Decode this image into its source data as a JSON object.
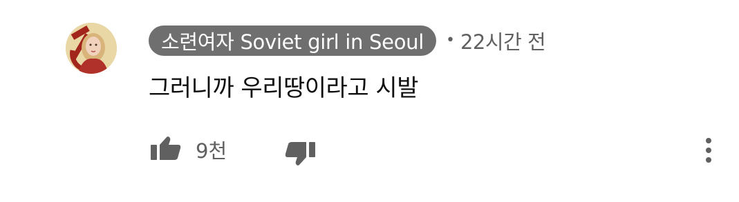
{
  "comment": {
    "author": "소련여자 Soviet girl in Seoul",
    "separator": "•",
    "timestamp": "22시간 전",
    "text": "그러니까 우리땅이라고 시발",
    "like_count": "9천"
  },
  "icons": {
    "like": "thumbs-up-icon",
    "dislike": "thumbs-down-icon",
    "more": "more-vertical-icon"
  },
  "colors": {
    "author_chip_bg": "#6f6f6f",
    "secondary_text": "#606060",
    "icon": "#606060"
  }
}
